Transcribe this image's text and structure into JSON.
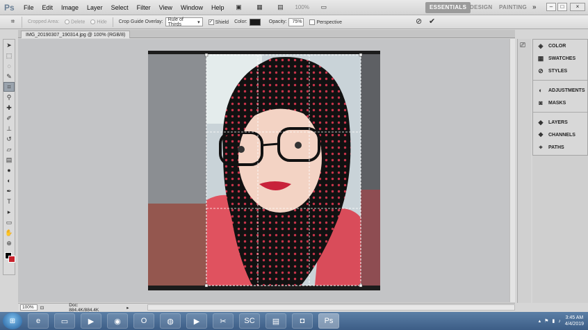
{
  "app": {
    "logo": "Ps"
  },
  "menu": [
    "File",
    "Edit",
    "Image",
    "Layer",
    "Select",
    "Filter",
    "View",
    "Window",
    "Help"
  ],
  "toolbar": {
    "zoom_value": "100%"
  },
  "workspaces": {
    "active": "ESSENTIALS",
    "items": [
      "DESIGN",
      "PAINTING"
    ],
    "more": "»"
  },
  "window_controls": {
    "minimize": "–",
    "restore": "□",
    "close": "×"
  },
  "options": {
    "cropped_area_label": "Cropped Area:",
    "delete_label": "Delete",
    "hide_label": "Hide",
    "guide_overlay_label": "Crop Guide Overlay:",
    "guide_overlay_value": "Rule of Thirds",
    "shield_label": "Shield",
    "color_label": "Color:",
    "shield_color": "#1a1a1a",
    "opacity_label": "Opacity:",
    "opacity_value": "75%",
    "perspective_label": "Perspective",
    "cancel_icon": "cancel-icon",
    "commit_icon": "commit-checkmark-icon"
  },
  "document": {
    "tab_title": "IMG_20190307_190314.jpg @ 100% (RGB/8)",
    "zoom": "100%",
    "doc_info": "Doc: 884.4K/884.4K"
  },
  "tools": [
    "move",
    "marquee",
    "lasso",
    "quick-select",
    "crop",
    "eyedropper",
    "healing",
    "brush",
    "clone-stamp",
    "history-brush",
    "eraser",
    "gradient",
    "blur",
    "dodge",
    "pen",
    "type",
    "path-select",
    "shape",
    "hand",
    "zoom"
  ],
  "colors": {
    "foreground": "#000000",
    "background": "#c8222c"
  },
  "panels": {
    "group1": [
      "COLOR",
      "SWATCHES",
      "STYLES"
    ],
    "group2": [
      "ADJUSTMENTS",
      "MASKS"
    ],
    "group3": [
      "LAYERS",
      "CHANNELS",
      "PATHS"
    ]
  },
  "taskbar": {
    "apps": [
      "windows-explorer-icon",
      "internet-explorer-icon",
      "file-manager-icon",
      "media-player-icon",
      "chrome-icon",
      "opera-icon",
      "firefox-icon",
      "app-green-icon",
      "paint-icon",
      "app-sc-icon",
      "document-viewer-icon",
      "camera-app-icon",
      "photoshop-icon"
    ],
    "clock_time": "3:45 AM",
    "clock_date": "4/4/2019"
  }
}
